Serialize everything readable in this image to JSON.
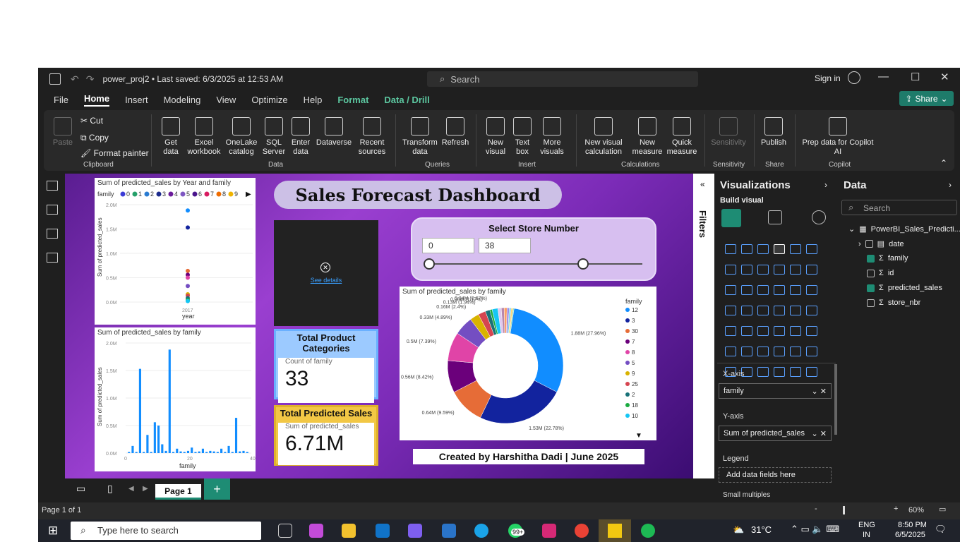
{
  "window": {
    "doc_title": "power_proj2 • Last saved: 6/3/2025 at 12:53 AM",
    "search_label": "Search",
    "sign_in": "Sign in"
  },
  "menu": [
    "File",
    "Home",
    "Insert",
    "Modeling",
    "View",
    "Optimize",
    "Help",
    "Format",
    "Data / Drill"
  ],
  "share_label": "Share",
  "ribbon": {
    "clipboard": {
      "paste": "Paste",
      "cut": "Cut",
      "copy": "Copy",
      "format_painter": "Format painter",
      "group": "Clipboard"
    },
    "data": {
      "get_data": "Get data",
      "excel": "Excel workbook",
      "onelake": "OneLake catalog",
      "sql": "SQL Server",
      "enter": "Enter data",
      "dataverse": "Dataverse",
      "recent": "Recent sources",
      "group": "Data"
    },
    "queries": {
      "transform": "Transform data",
      "refresh": "Refresh",
      "group": "Queries"
    },
    "insert": {
      "new_visual": "New visual",
      "text_box": "Text box",
      "more": "More visuals",
      "group": "Insert"
    },
    "calc": {
      "visual_calc": "New visual calculation",
      "measure": "New measure",
      "quick": "Quick measure",
      "group": "Calculations"
    },
    "sensitivity": {
      "label": "Sensitivity",
      "group": "Sensitivity"
    },
    "share": {
      "publish": "Publish",
      "group": "Share"
    },
    "copilot": {
      "prep": "Prep data for Copilot AI",
      "group": "Copilot"
    }
  },
  "dashboard": {
    "title": "Sales Forecast Dashboard",
    "see_details": "See details",
    "kpi1": {
      "header": "Total Product Categories",
      "label": "Count of family",
      "value": "33"
    },
    "kpi2": {
      "header": "Total Predicted Sales",
      "label": "Sum of predicted_sales",
      "value": "6.71M"
    },
    "store": {
      "header": "Select Store Number",
      "min": "0",
      "max": "38"
    },
    "credit": "Created by Harshitha Dadi | June 2025"
  },
  "chart_data": [
    {
      "type": "scatter",
      "title": "Sum of predicted_sales by Year and family",
      "legend_title": "family",
      "legend": [
        "0",
        "1",
        "2",
        "3",
        "4",
        "5",
        "6",
        "7",
        "8",
        "9"
      ],
      "legend_colors": [
        "#3b3bd6",
        "#25a06a",
        "#2a7bd1",
        "#1b2a8c",
        "#6a1b9a",
        "#7e57c2",
        "#4a148c",
        "#d81b60",
        "#ef6c00",
        "#f0b400"
      ],
      "xlabel": "year",
      "ylabel": "Sum of predicted_sales",
      "x_ticks": [
        "2017"
      ],
      "y_ticks": [
        "0.0M",
        "0.5M",
        "1.0M",
        "1.5M",
        "2.0M"
      ],
      "ylim": [
        0,
        2.0
      ],
      "points_y": [
        1.88,
        1.53,
        0.64,
        0.56,
        0.5,
        0.33,
        0.16,
        0.13,
        0.08,
        0.04,
        0.02
      ]
    },
    {
      "type": "bar",
      "title": "Sum of predicted_sales by family",
      "xlabel": "family",
      "ylabel": "Sum of predicted_sales",
      "x_ticks": [
        "0",
        "20",
        "40"
      ],
      "y_ticks": [
        "0.0M",
        "0.5M",
        "1.0M",
        "1.5M",
        "2.0M"
      ],
      "ylim": [
        0,
        2.0
      ],
      "values": [
        0.02,
        0.13,
        0.02,
        1.53,
        0.02,
        0.33,
        0.02,
        0.56,
        0.5,
        0.16,
        0.04,
        1.88,
        0.02,
        0.08,
        0.03,
        0.02,
        0.04,
        0.1,
        0.02,
        0.03,
        0.08,
        0.02,
        0.04,
        0.03,
        0.02,
        0.08,
        0.02,
        0.13,
        0.02,
        0.64,
        0.03,
        0.04,
        0.02
      ]
    },
    {
      "type": "pie",
      "title": "Sum of predicted_sales by family",
      "legend_title": "family",
      "legend": [
        "12",
        "3",
        "30",
        "7",
        "8",
        "5",
        "9",
        "25",
        "2",
        "18",
        "10"
      ],
      "legend_colors": [
        "#118dff",
        "#12239e",
        "#e66c37",
        "#6b007b",
        "#e044a7",
        "#744ec2",
        "#d9b300",
        "#d64550",
        "#197278",
        "#1aab40",
        "#15c6f4"
      ],
      "slices": [
        {
          "label": "1.88M (27.96%)",
          "value": 1.88
        },
        {
          "label": "1.53M (22.78%)",
          "value": 1.53
        },
        {
          "label": "0.64M (9.59%)",
          "value": 0.64
        },
        {
          "label": "0.56M (8.42%)",
          "value": 0.56
        },
        {
          "label": "0.5M (7.39%)",
          "value": 0.5
        },
        {
          "label": "0.33M (4.89%)",
          "value": 0.33
        },
        {
          "label": "0.16M (2.4%)",
          "value": 0.16
        },
        {
          "label": "0.13M (1.94%)",
          "value": 0.13
        },
        {
          "label": "0.08M (1.17%)",
          "value": 0.08
        },
        {
          "label": "0.04M (0.67%)",
          "value": 0.04
        },
        {
          "label": "",
          "value": 0.1
        },
        {
          "label": "",
          "value": 0.06
        },
        {
          "label": "",
          "value": 0.05
        },
        {
          "label": "",
          "value": 0.05
        },
        {
          "label": "",
          "value": 0.04
        },
        {
          "label": "",
          "value": 0.03
        },
        {
          "label": "",
          "value": 0.03
        },
        {
          "label": "",
          "value": 0.02
        }
      ]
    }
  ],
  "filters_label": "Filters",
  "viz": {
    "header": "Visualizations",
    "build": "Build visual",
    "xaxis": "X-axis",
    "xfield": "family",
    "yaxis": "Y-axis",
    "yfield": "Sum of predicted_sales",
    "legend": "Legend",
    "legend_placeholder": "Add data fields here",
    "small_multiples": "Small multiples"
  },
  "data_pane": {
    "header": "Data",
    "search": "Search",
    "table": "PowerBI_Sales_Predicti...",
    "fields": [
      {
        "name": "date",
        "checked": false
      },
      {
        "name": "family",
        "checked": true
      },
      {
        "name": "id",
        "checked": false
      },
      {
        "name": "predicted_sales",
        "checked": true
      },
      {
        "name": "store_nbr",
        "checked": false
      }
    ]
  },
  "page_tab": "Page 1",
  "status": {
    "page": "Page 1 of 1",
    "zoom": "60%"
  },
  "taskbar": {
    "search": "Type here to search",
    "temp": "31°C",
    "lang1": "ENG",
    "lang2": "IN",
    "time": "8:50 PM",
    "date": "6/5/2025",
    "badge": "99+"
  }
}
